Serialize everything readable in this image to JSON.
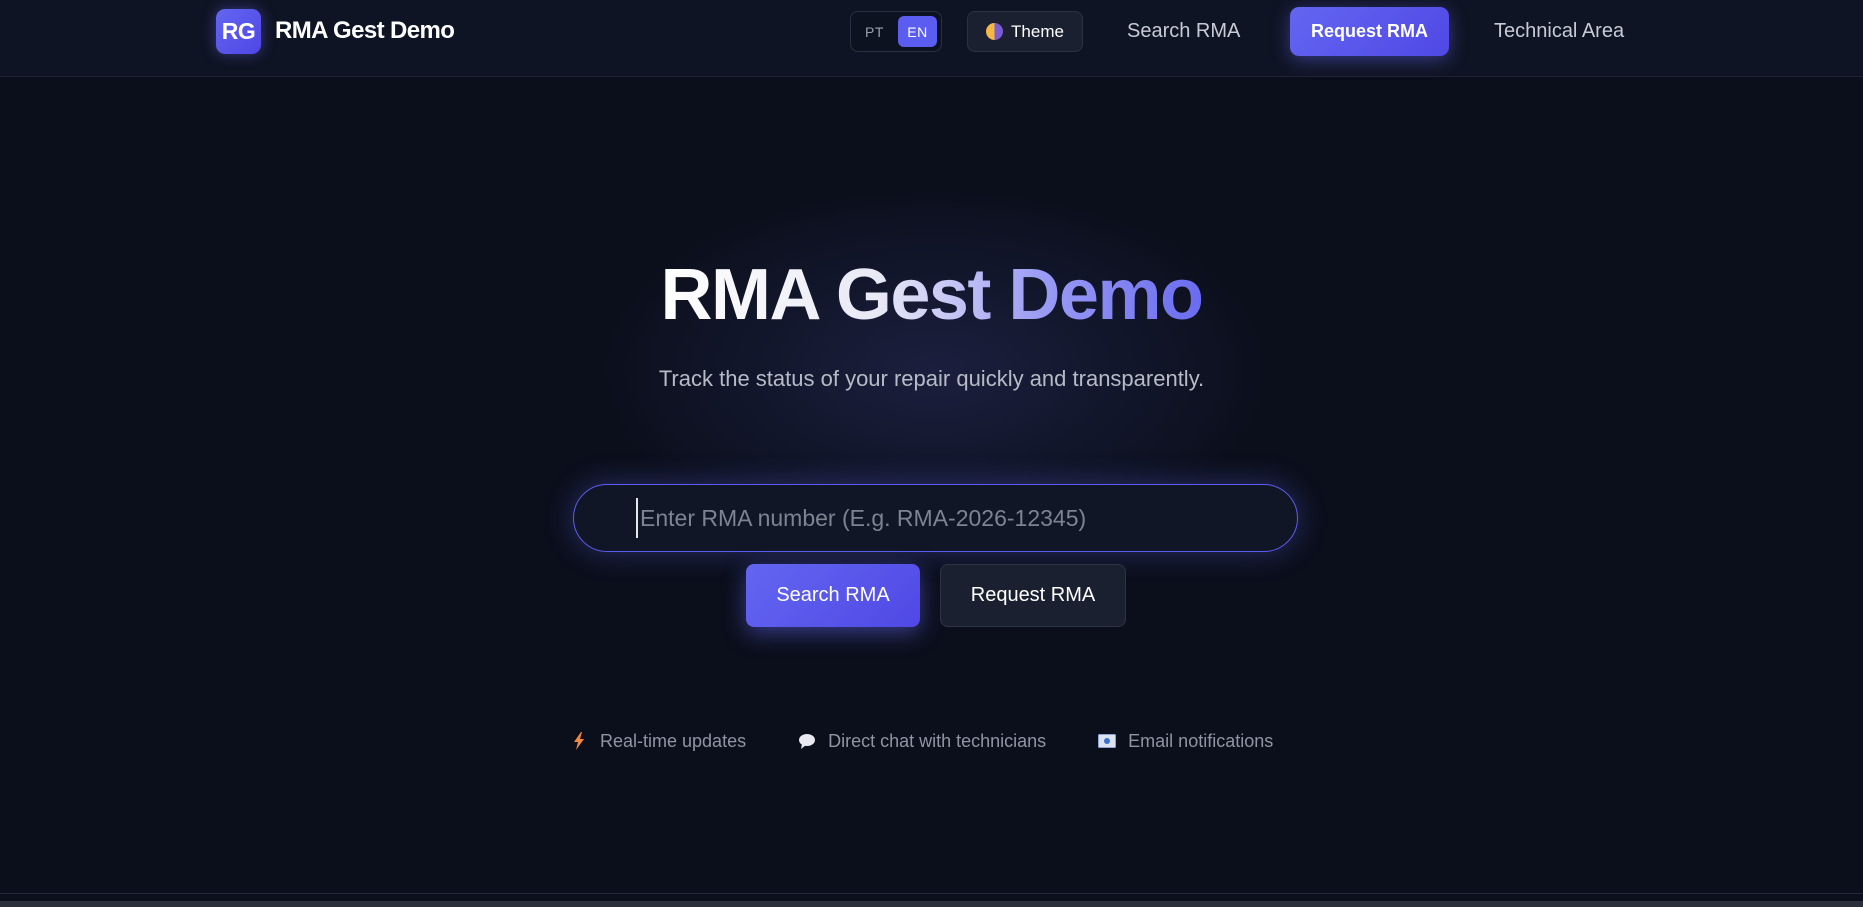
{
  "header": {
    "brand_logo": "RG",
    "brand_name": "RMA Gest Demo",
    "languages": [
      "PT",
      "EN"
    ],
    "active_language": "EN",
    "theme_label": "Theme",
    "nav_search": "Search RMA",
    "nav_request": "Request RMA",
    "nav_technical": "Technical Area"
  },
  "hero": {
    "title": "RMA Gest Demo",
    "subtitle": "Track the status of your repair quickly and transparently."
  },
  "search": {
    "placeholder": "Enter RMA number (E.g. RMA-2026-12345)",
    "value": "",
    "search_button": "Search RMA",
    "request_button": "Request RMA"
  },
  "features": [
    {
      "icon": "bolt-icon",
      "label": "Real-time updates"
    },
    {
      "icon": "chat-bubble-icon",
      "label": "Direct chat with technicians"
    },
    {
      "icon": "email-icon",
      "label": "Email notifications"
    }
  ],
  "colors": {
    "accent": "#6366f1",
    "background": "#0b0f1c",
    "header_bg": "#0f1424"
  }
}
